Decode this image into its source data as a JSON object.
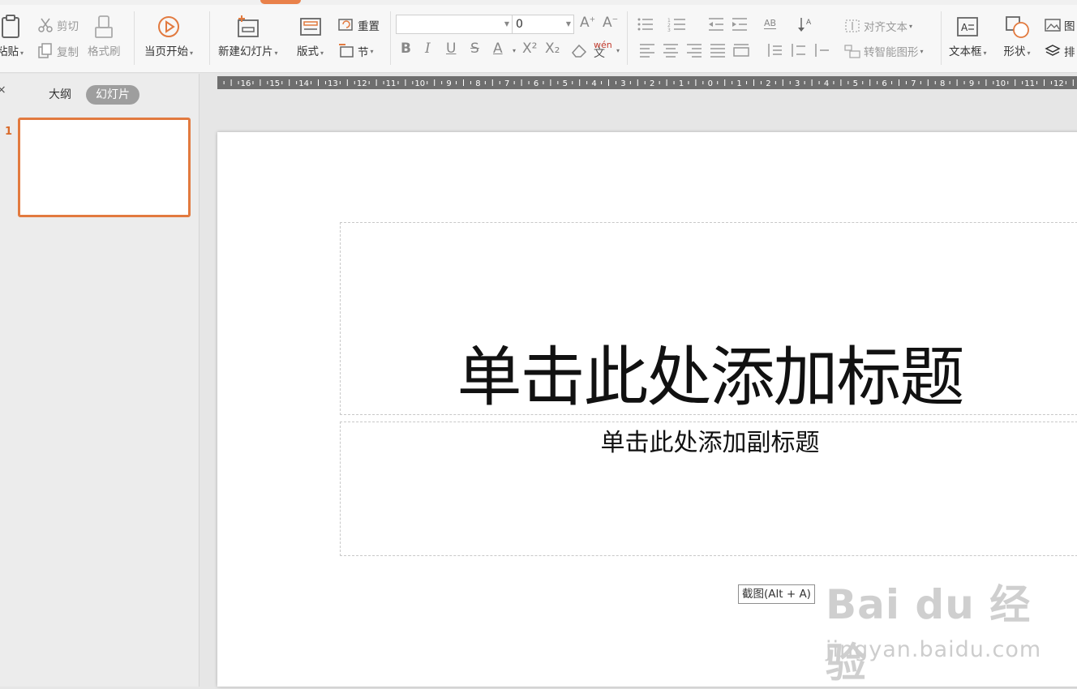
{
  "ribbon": {
    "paste_label": "粘贴",
    "cut_label": "剪切",
    "copy_label": "复制",
    "format_painter_label": "格式刷",
    "from_current_label": "当页开始",
    "new_slide_label": "新建幻灯片",
    "layout_label": "版式",
    "reset_label": "重置",
    "section_label": "节",
    "font_name_value": "",
    "font_size_value": "0",
    "bold_label": "B",
    "italic_label": "I",
    "underline_label": "U",
    "strike_label": "S",
    "font_color_label": "A",
    "superscript_label": "X²",
    "subscript_label": "X₂",
    "pinyin_label": "wén",
    "align_text_label": "对齐文本",
    "smartart_label": "转智能图形",
    "textbox_label": "文本框",
    "shape_label": "形状",
    "picture_label": "图",
    "arrange_label": "排"
  },
  "sidebar": {
    "tabs": [
      {
        "label": "大纲",
        "active": false
      },
      {
        "label": "幻灯片",
        "active": true
      }
    ],
    "slide_number": "1"
  },
  "ruler": {
    "labels": [
      "16",
      "15",
      "14",
      "13",
      "12",
      "11",
      "10",
      "9",
      "8",
      "7",
      "6",
      "5",
      "4",
      "3",
      "2",
      "1",
      "0",
      "1",
      "2",
      "3",
      "4",
      "5",
      "6",
      "7",
      "8",
      "9",
      "10",
      "11",
      "12"
    ]
  },
  "slide": {
    "title_placeholder": "单击此处添加标题",
    "subtitle_placeholder": "单击此处添加副标题"
  },
  "tooltip": "截图(Alt + A)",
  "watermark": {
    "brand": "Bai du 经验",
    "url": "jingyan.baidu.com"
  },
  "colors": {
    "accent": "#e27a3f",
    "ruler_bg": "#6e6e6e",
    "toolbar_bg": "#f7f7f7"
  }
}
